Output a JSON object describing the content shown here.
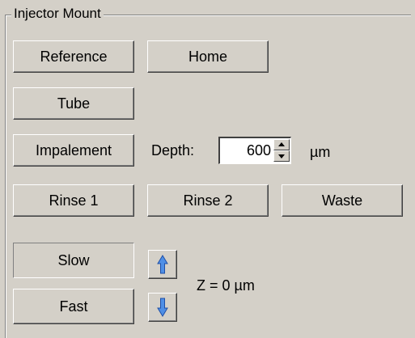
{
  "group": {
    "title": "Injector Mount"
  },
  "buttons": {
    "reference": "Reference",
    "home": "Home",
    "tube": "Tube",
    "impalement": "Impalement",
    "rinse1": "Rinse 1",
    "rinse2": "Rinse 2",
    "waste": "Waste",
    "slow": "Slow",
    "fast": "Fast"
  },
  "depth": {
    "label": "Depth:",
    "value": "600",
    "unit": "µm"
  },
  "z_readout": "Z = 0 µm",
  "icons": {
    "z_up": "arrow-up-icon",
    "z_down": "arrow-down-icon"
  },
  "colors": {
    "background": "#d4d0c8",
    "arrow_fill": "#4f8fe6",
    "arrow_stroke": "#1e4fa8"
  },
  "state": {
    "slow_pressed": true
  }
}
